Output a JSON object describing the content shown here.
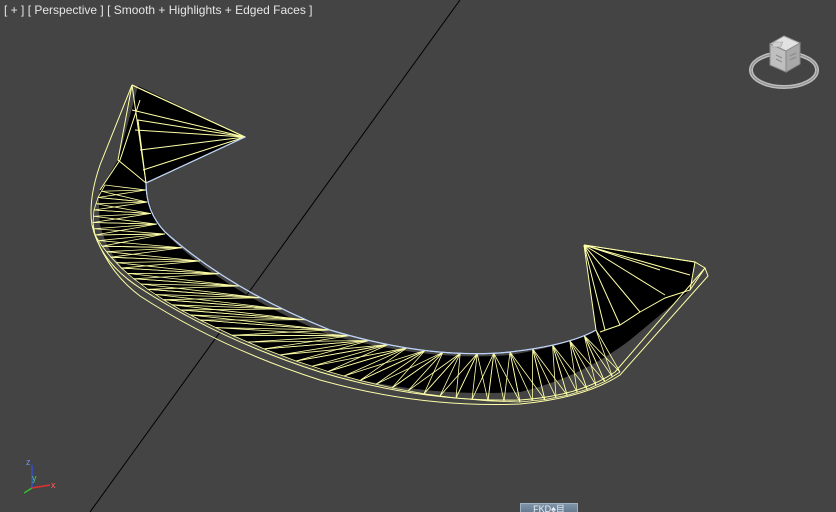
{
  "viewport": {
    "label_plus": "[ + ]",
    "label_view": "[ Perspective ]",
    "label_shading": "[ Smooth + Highlights + Edged Faces ]",
    "wire_color": "#ffffa8",
    "face_color": "#000000",
    "edge_highlight_color": "#bcd3ff",
    "grid_line_color": "#000000",
    "background_color": "#444444"
  },
  "viewcube": {
    "icon": "viewcube-icon"
  },
  "axis_tripod": {
    "x": "x",
    "y": "y",
    "z": "z",
    "x_color": "#e03030",
    "y_color": "#30c030",
    "z_color": "#3050e0"
  },
  "status_tab": {
    "label": "FKD♠目"
  }
}
